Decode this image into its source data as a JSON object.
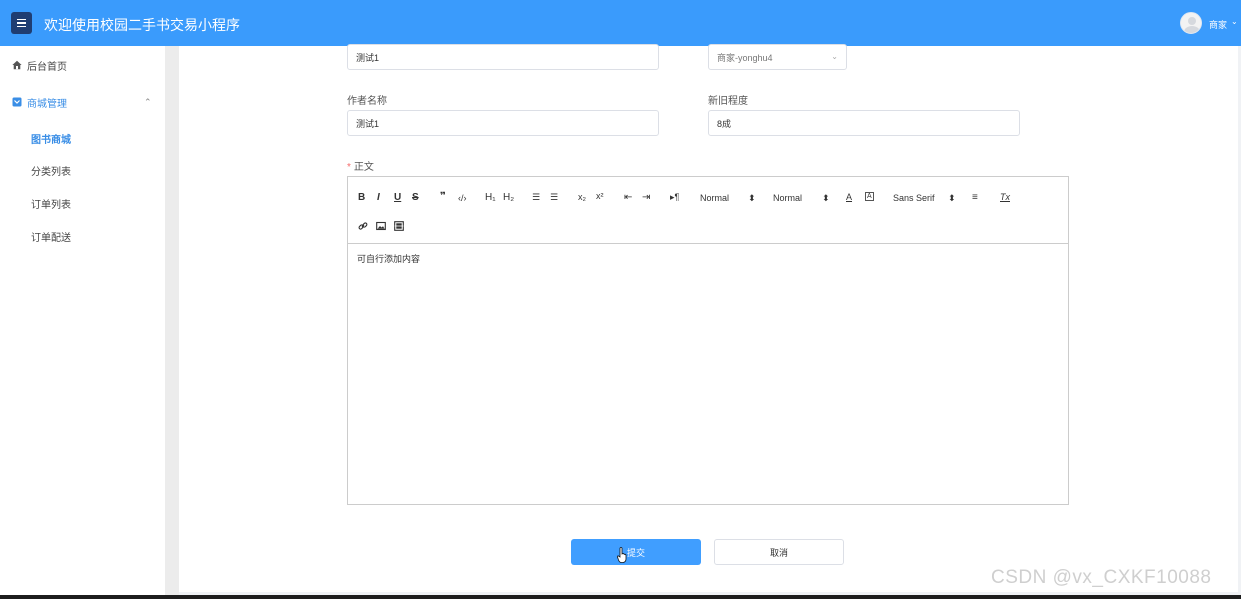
{
  "header": {
    "title": "欢迎使用校园二手书交易小程序",
    "user_name": "商家",
    "user_caret": "⌄"
  },
  "sidebar": {
    "home": "后台首页",
    "group": "商城管理",
    "group_chevron": "⌃",
    "items": [
      {
        "label": "图书商城",
        "active": true
      },
      {
        "label": "分类列表",
        "active": false
      },
      {
        "label": "订单列表",
        "active": false
      },
      {
        "label": "订单配送",
        "active": false
      }
    ]
  },
  "form": {
    "title_value": "测试1",
    "merchant_value": "商家-yonghu4",
    "author_label": "作者名称",
    "author_value": "测试1",
    "condition_label": "新旧程度",
    "condition_value": "8成",
    "body_label": "正文",
    "body_required_mark": "*",
    "body_content": "可自行添加内容"
  },
  "toolbar": {
    "bold": "B",
    "italic": "I",
    "underline": "U",
    "strike": "S",
    "blockquote": "❞",
    "code": "‹/›",
    "h1": "H₁",
    "h2": "H₂",
    "ordered_list": "☰",
    "bullet_list": "☰",
    "subscript": "x₂",
    "superscript": "x²",
    "outdent": "⇤",
    "indent": "⇥",
    "direction": "▸¶",
    "size_select": "Normal",
    "header_select": "Normal",
    "font_select": "Sans Serif",
    "select_caret": "⬍",
    "color": "A",
    "background": "A",
    "align": "≡",
    "clean": "Tx"
  },
  "buttons": {
    "submit": "提交",
    "cancel": "取消"
  },
  "watermark": "CSDN @vx_CXKF10088",
  "colors": {
    "header": "#3a9bfc",
    "primary": "#409eff",
    "active_nav": "#3a8ee6"
  }
}
